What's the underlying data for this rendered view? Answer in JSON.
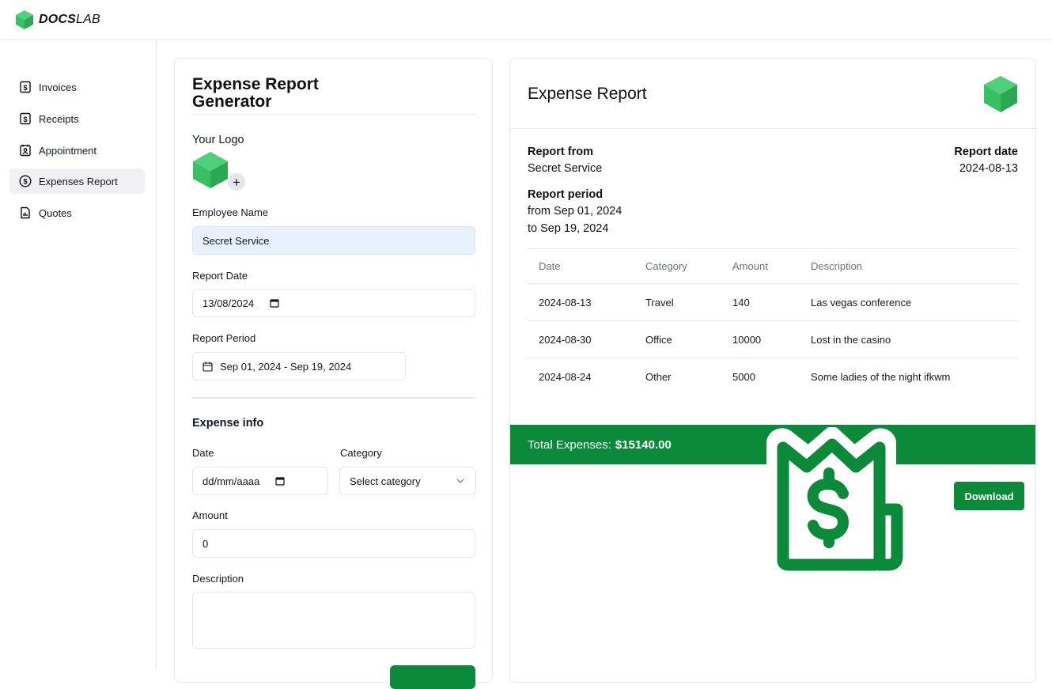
{
  "brand": {
    "bold": "DOCS",
    "light": "LAB",
    "color": "#36c263"
  },
  "sidebar": {
    "items": [
      {
        "label": "Invoices",
        "icon": "invoice-dollar-icon",
        "active": false
      },
      {
        "label": "Receipts",
        "icon": "receipt-dollar-icon",
        "active": false
      },
      {
        "label": "Appointment",
        "icon": "appointment-badge-icon",
        "active": false
      },
      {
        "label": "Expenses Report",
        "icon": "dollar-circle-icon",
        "active": true
      },
      {
        "label": "Quotes",
        "icon": "quote-chart-icon",
        "active": false
      }
    ]
  },
  "form": {
    "title": "Expense Report Generator",
    "logo_label": "Your Logo",
    "employee_label": "Employee Name",
    "employee_value": "Secret Service",
    "report_date_label": "Report Date",
    "report_date_value": "13/08/2024",
    "report_period_label": "Report Period",
    "report_period_value": "Sep 01, 2024 - Sep 19, 2024",
    "expense_info_title": "Expense info",
    "date_label": "Date",
    "date_placeholder": "dd/mm/aaaa",
    "category_label": "Category",
    "category_placeholder": "Select category",
    "amount_label": "Amount",
    "amount_value": "0",
    "description_label": "Description",
    "description_value": ""
  },
  "report": {
    "title": "Expense Report",
    "from_label": "Report from",
    "from_value": "Secret Service",
    "date_label": "Report date",
    "date_value": "2024-08-13",
    "period_label": "Report period",
    "period_from": "from Sep 01, 2024",
    "period_to": "to Sep 19, 2024",
    "columns": [
      "Date",
      "Category",
      "Amount",
      "Description"
    ],
    "rows": [
      {
        "date": "2024-08-13",
        "category": "Travel",
        "amount": "140",
        "description": "Las vegas conference"
      },
      {
        "date": "2024-08-30",
        "category": "Office",
        "amount": "10000",
        "description": "Lost in the casino"
      },
      {
        "date": "2024-08-24",
        "category": "Other",
        "amount": "5000",
        "description": "Some ladies of the night ifkwm"
      }
    ],
    "total_label": "Total Expenses:",
    "total_value": "$15140.00",
    "download_label": "Download",
    "accent": "#0b8a3a"
  }
}
